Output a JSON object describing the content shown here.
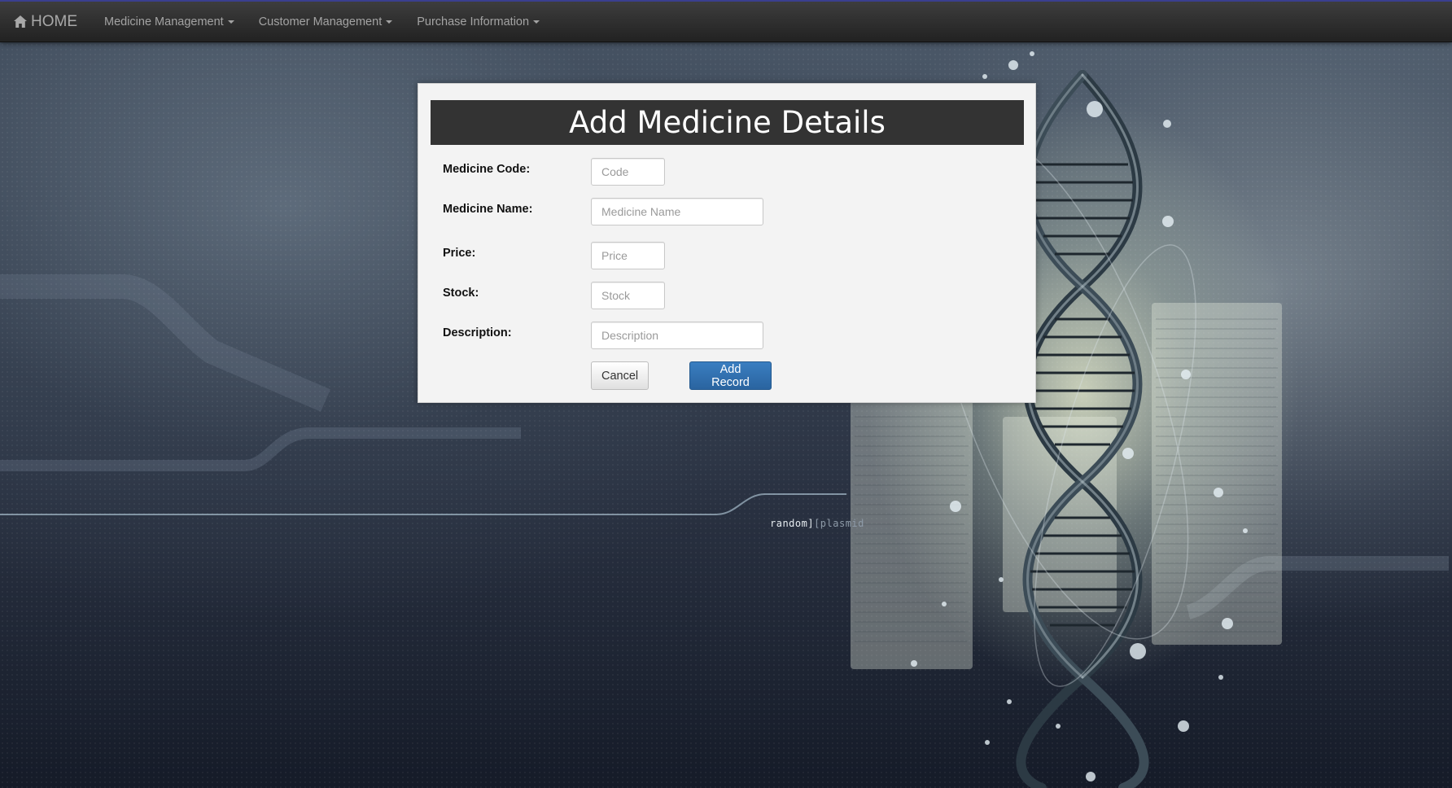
{
  "navbar": {
    "brand_label": "HOME",
    "items": [
      {
        "label": "Medicine Management"
      },
      {
        "label": "Customer Management"
      },
      {
        "label": "Purchase Information"
      }
    ]
  },
  "form": {
    "title": "Add Medicine Details",
    "fields": [
      {
        "label": "Medicine Code:",
        "placeholder": "Code",
        "value": ""
      },
      {
        "label": "Medicine Name:",
        "placeholder": "Medicine Name",
        "value": ""
      },
      {
        "label": "Price:",
        "placeholder": "Price",
        "value": ""
      },
      {
        "label": "Stock:",
        "placeholder": "Stock",
        "value": ""
      },
      {
        "label": "Description:",
        "placeholder": "Description",
        "value": ""
      }
    ],
    "cancel_label": "Cancel",
    "submit_label": "Add Record"
  },
  "background": {
    "watermark_main": "random]",
    "watermark_dim": "[plasmid"
  },
  "colors": {
    "navbar": "#222222",
    "panel_header": "#333333",
    "primary_button": "#2a64a0"
  },
  "icons": {
    "home": "home-icon",
    "dropdown": "caret-down-icon"
  }
}
